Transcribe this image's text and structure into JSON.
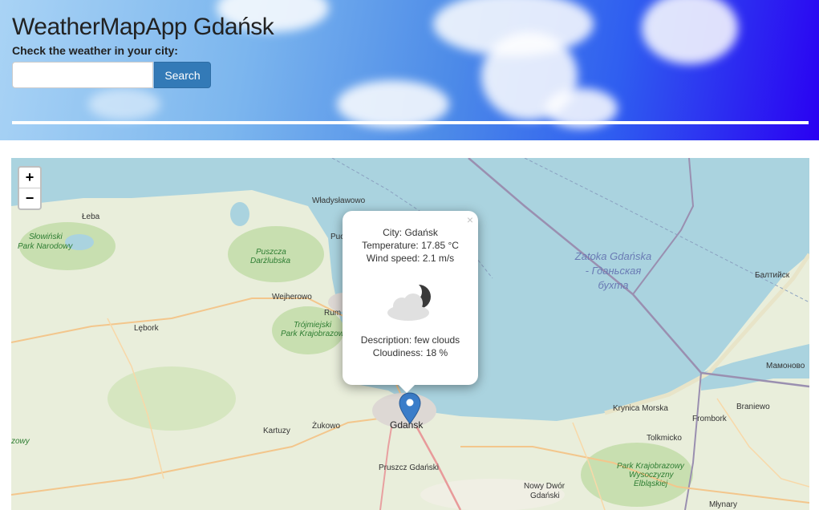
{
  "header": {
    "title": "WeatherMapApp Gdańsk",
    "subtitle": "Check the weather in your city:",
    "search_placeholder": "",
    "search_button": "Search"
  },
  "map": {
    "zoom_in": "+",
    "zoom_out": "−",
    "popup": {
      "close": "×",
      "city": "City: Gdańsk",
      "temperature": "Temperature: 17.85 °C",
      "wind": "Wind speed: 2.1 m/s",
      "description": "Description: few clouds",
      "cloudiness": "Cloudiness: 18 %",
      "icon": "few-clouds-night-icon"
    },
    "labels": {
      "wladyslawowo": "Władysławowo",
      "leba": "Łeba",
      "slowinski": "Słowiński",
      "park_narodowy": "Park Narodowy",
      "puszcza": "Puszcza",
      "darzlubska": "Darżlubska",
      "puck": "Puc",
      "wejherowo": "Wejherowo",
      "rumia": "Rum",
      "lebork": "Lębork",
      "trojmiejski": "Trójmiejski",
      "park_krajobrazowy": "Park Krajobrazow",
      "zatoka1": "Zatoka Gdańska",
      "zatoka2": "- Гданьская",
      "zatoka3": "бухта",
      "baltiysk": "Балтийск",
      "mamonovo": "Мамоново",
      "krynica": "Krynica Morska",
      "frombork": "Frombork",
      "braniewo": "Braniewo",
      "gdansk": "Gdańsk",
      "zukowo": "Żukowo",
      "kartuzy": "Kartuzy",
      "pruszcz": "Pruszcz Gdański",
      "tolkmicko": "Tolkmicko",
      "nowy_dwor1": "Nowy Dwór",
      "nowy_dwor2": "Gdański",
      "pk_wys1": "Park Krajobrazowy",
      "pk_wys2": "Wysoczyzny",
      "pk_wys3": "Elbląskiej",
      "mlynary": "Młynary",
      "ozowy": "zowy"
    }
  }
}
